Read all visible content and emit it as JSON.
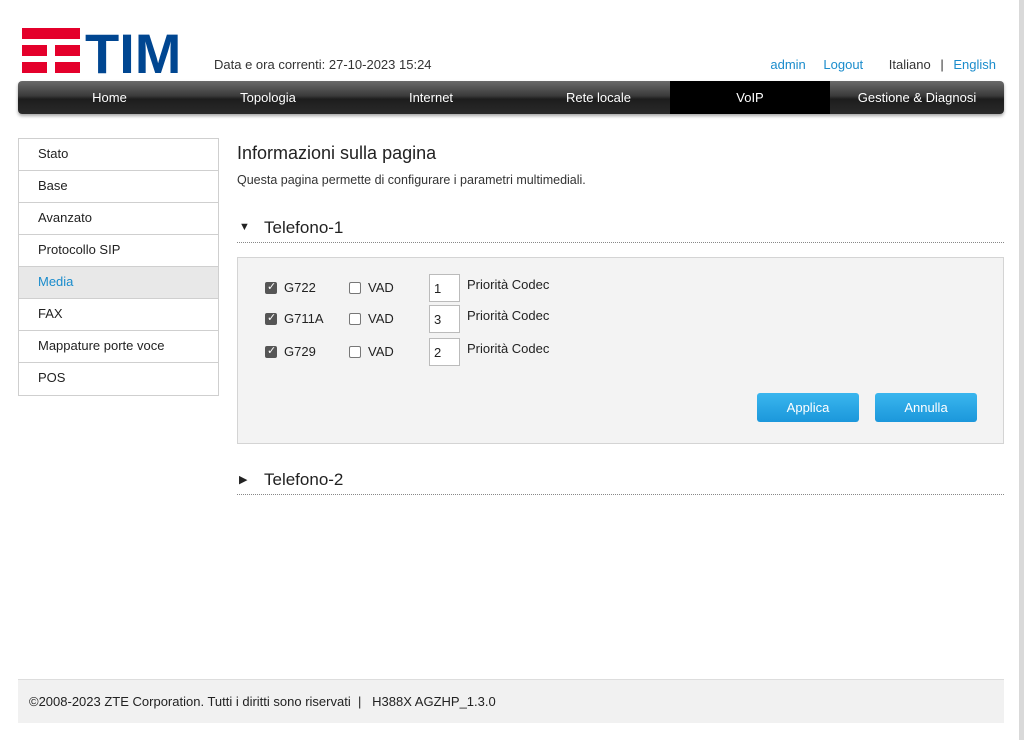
{
  "header": {
    "datetime": "Data e ora correnti: 27-10-2023 15:24",
    "user": "admin",
    "logout": "Logout",
    "lang_it": "Italiano",
    "lang_sep": "|",
    "lang_en": "English",
    "logo_text": "TIM"
  },
  "nav": {
    "items": [
      "Home",
      "Topologia",
      "Internet",
      "Rete locale",
      "VoIP",
      "Gestione & Diagnosi"
    ],
    "active": "VoIP"
  },
  "sidebar": {
    "items": [
      "Stato",
      "Base",
      "Avanzato",
      "Protocollo SIP",
      "Media",
      "FAX",
      "Mappature porte voce",
      "POS"
    ],
    "active": "Media"
  },
  "main": {
    "title": "Informazioni sulla pagina",
    "description": "Questa pagina permette di configurare i parametri multimediali.",
    "sections": [
      {
        "label": "Telefono-1",
        "expanded": true,
        "codecs": [
          {
            "name": "G722",
            "enabled": true,
            "vad_label": "VAD",
            "vad": false,
            "priority": "1",
            "priority_label": "Priorità Codec"
          },
          {
            "name": "G711A",
            "enabled": true,
            "vad_label": "VAD",
            "vad": false,
            "priority": "3",
            "priority_label": "Priorità Codec"
          },
          {
            "name": "G729",
            "enabled": true,
            "vad_label": "VAD",
            "vad": false,
            "priority": "2",
            "priority_label": "Priorità Codec"
          }
        ],
        "apply_label": "Applica",
        "cancel_label": "Annulla"
      },
      {
        "label": "Telefono-2",
        "expanded": false
      }
    ]
  },
  "footer": {
    "text": "©2008-2023 ZTE Corporation. Tutti i diritti sono riservati  |   H388X AGZHP_1.3.0"
  },
  "colors": {
    "brand_red": "#e4002b",
    "brand_blue": "#004691",
    "accent": "#1a8ccc",
    "button": "#2aa7e6"
  }
}
